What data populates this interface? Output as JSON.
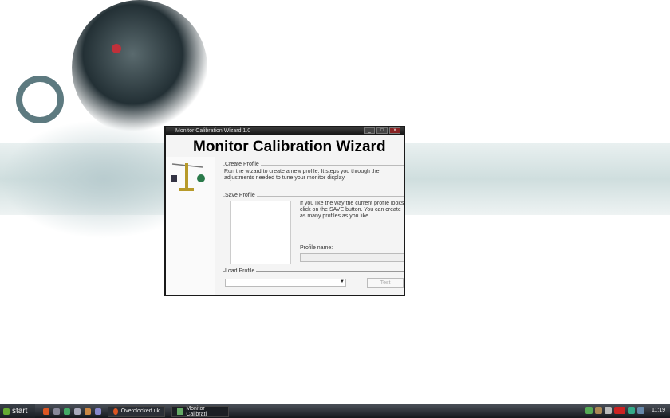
{
  "window": {
    "title": "Monitor Calibration Wizard 1.0",
    "heading": "Monitor Calibration Wizard",
    "create_profile": {
      "label": "Create Profile",
      "text": "Run the wizard to create a new profile. It steps you through the adjustments needed to tune your monitor display."
    },
    "save_profile": {
      "label": "Save Profile",
      "text": "If you like the way the current profile looks, click on the SAVE button. You can create as many profiles as you like.",
      "profile_name_label": "Profile name:",
      "profile_name_value": ""
    },
    "load_profile": {
      "label": "Load Profile",
      "selected": "",
      "test_button": "Test"
    },
    "controls": {
      "minimize": "_",
      "maximize": "□",
      "close": "x"
    }
  },
  "taskbar": {
    "start": "start",
    "tasks": [
      {
        "label": "Overclocked.uk"
      },
      {
        "label": "Monitor Calibrati"
      }
    ],
    "clock": "11:19"
  }
}
